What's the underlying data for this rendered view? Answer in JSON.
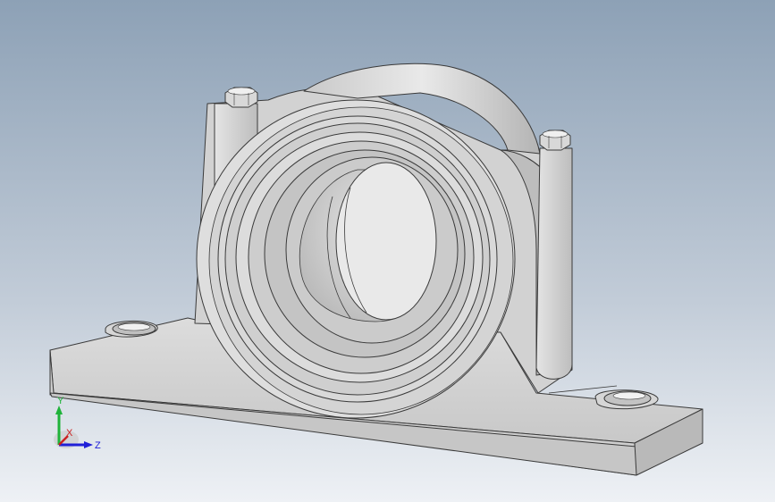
{
  "viewport": {
    "background_top": "#8da1b6",
    "background_bottom": "#eef1f5"
  },
  "model": {
    "body_color": "#d0d0d0",
    "face_color": "#e2e2e2",
    "shadow_color": "#a9a9a9",
    "edge_color": "#3a3a3a"
  },
  "triad": {
    "y_label": "Y",
    "z_label": "Z",
    "x_label": "X",
    "y_color": "#1fb33a",
    "z_color": "#2020d8",
    "x_color": "#cc2020"
  }
}
